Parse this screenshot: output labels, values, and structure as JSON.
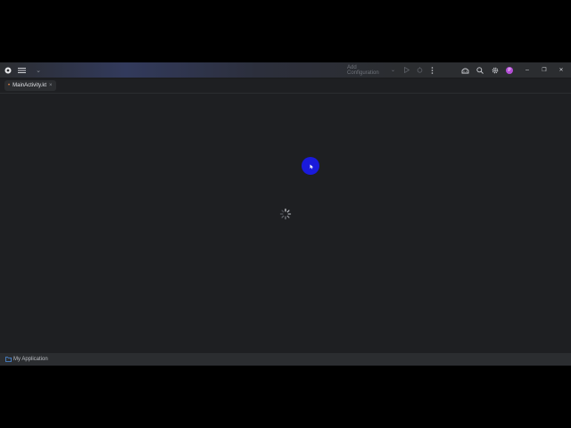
{
  "titlebar": {
    "run_config_label": "Add Configuration",
    "run_config_chevron": "⌄",
    "project_dropdown": "⌄",
    "avatar_initial": "P",
    "minimize": "–",
    "restore": "❐",
    "close": "✕",
    "colors": {
      "accent": "#b44ed6",
      "background": "#2b2d30"
    }
  },
  "editor_tabs": [
    {
      "label": "MainActivity.kt",
      "close": "×",
      "modified_marker": "•"
    }
  ],
  "statusbar": {
    "project_label": "My Application"
  },
  "editor": {
    "state": "loading"
  }
}
